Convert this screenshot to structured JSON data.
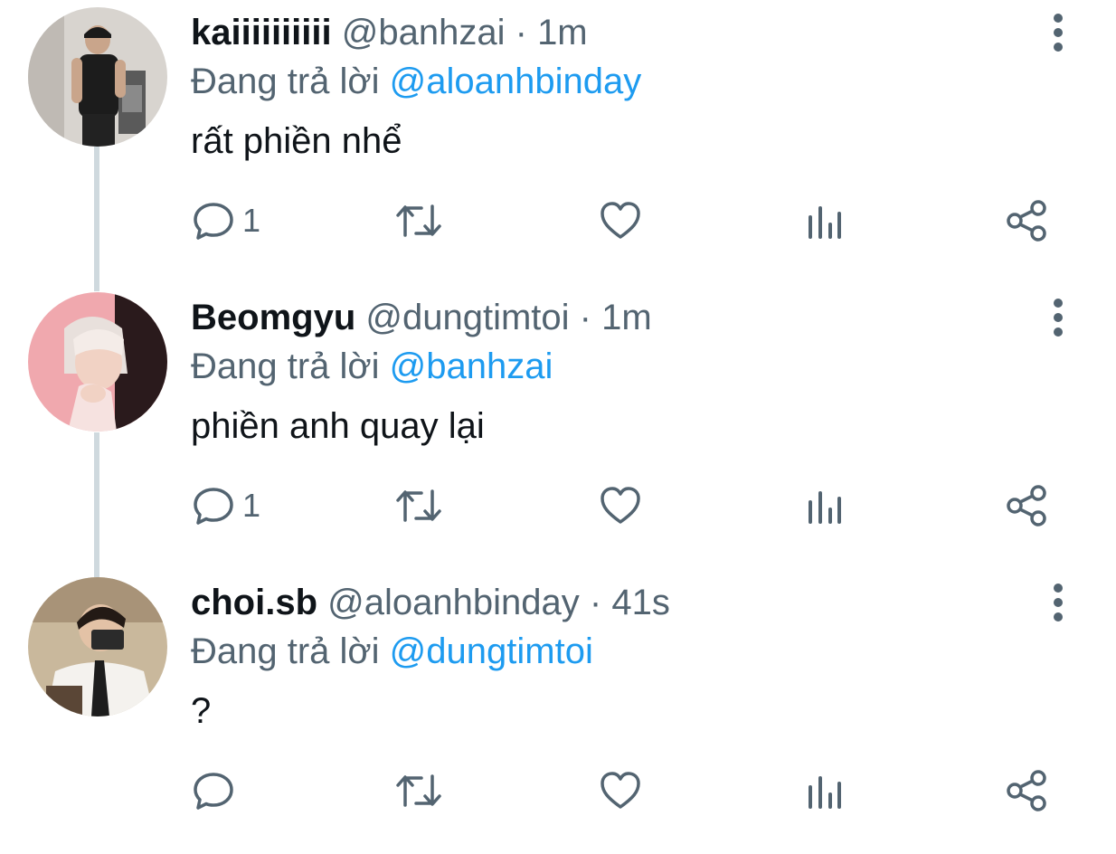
{
  "tweets": [
    {
      "display_name": "kaiiiiiiiiii",
      "handle": "@banhzai",
      "separator": "·",
      "time": "1m",
      "reply_prefix": "Đang trả lời",
      "reply_to": "@aloanhbinday",
      "text": "rất phiền nhể",
      "reply_count": "1",
      "avatar": "avatar-man-black-shirt-mirror-selfie"
    },
    {
      "display_name": "Beomgyu",
      "handle": "@dungtimtoi",
      "separator": "·",
      "time": "1m",
      "reply_prefix": "Đang trả lời",
      "reply_to": "@banhzai",
      "text": "phiền anh quay lại",
      "reply_count": "1",
      "avatar": "avatar-person-pink-background"
    },
    {
      "display_name": "choi.sb",
      "handle": "@aloanhbinday",
      "separator": "·",
      "time": "41s",
      "reply_prefix": "Đang trả lời",
      "reply_to": "@dungtimtoi",
      "text": "?",
      "reply_count": "",
      "avatar": "avatar-man-white-shirt-tie-selfie"
    }
  ],
  "icons": {
    "reply": "reply-bubble-icon",
    "retweet": "retweet-icon",
    "like": "heart-icon",
    "views": "views-bar-chart-icon",
    "share": "share-icon",
    "more": "more-vertical-icon"
  },
  "colors": {
    "text_primary": "#0f1419",
    "text_secondary": "#536471",
    "link": "#1d9bf0",
    "thread_line": "#cfd9de"
  }
}
